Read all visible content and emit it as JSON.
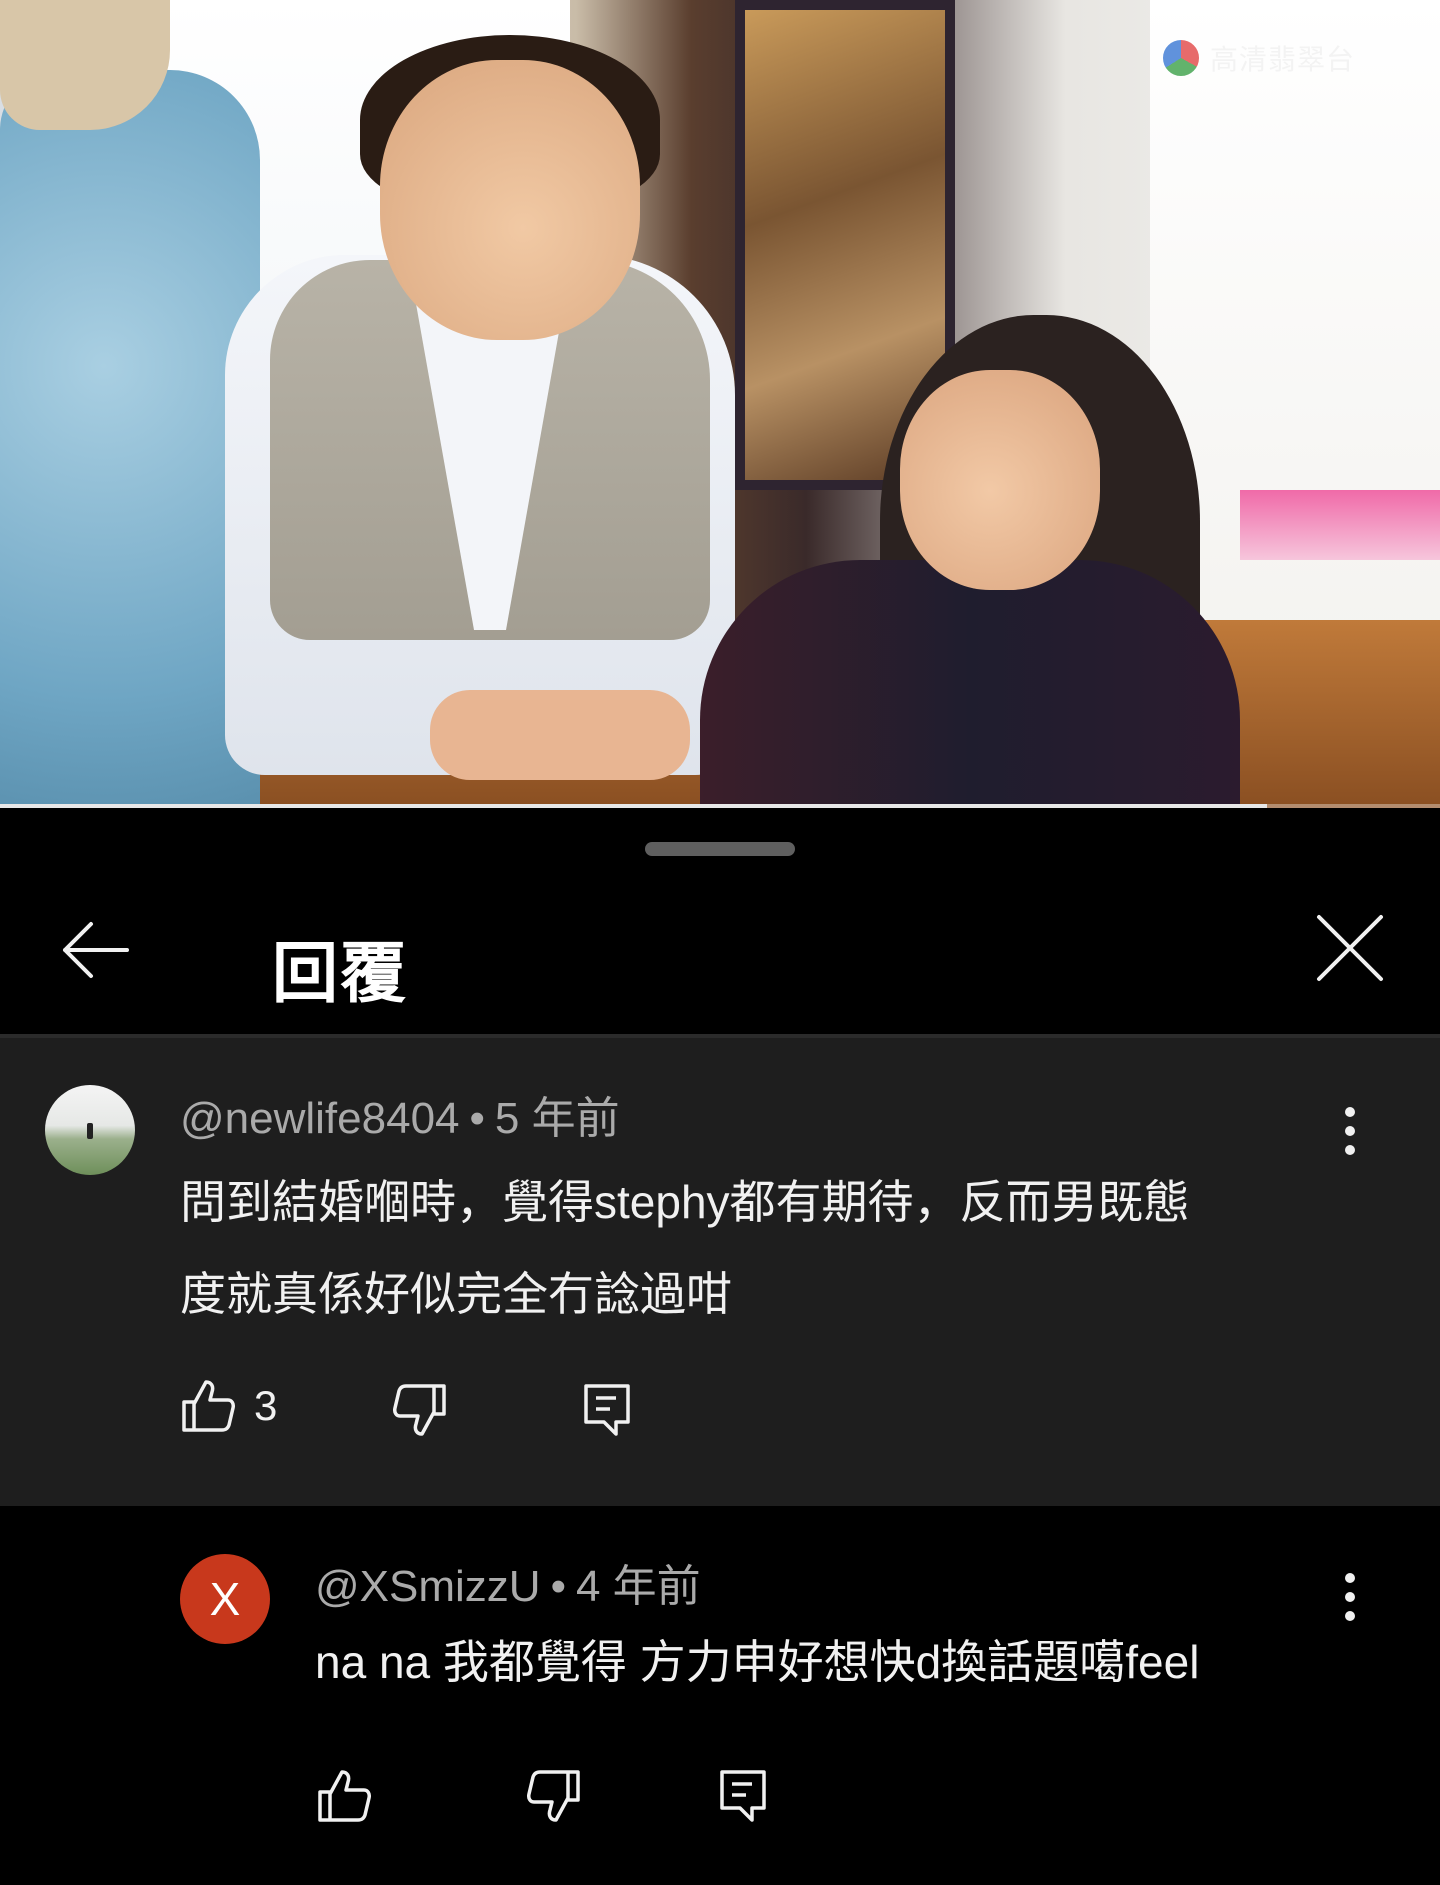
{
  "video": {
    "watermark": "高清翡翠台",
    "progress_fraction": 0.88
  },
  "header": {
    "title": "回覆"
  },
  "parent_comment": {
    "author": "@newlife8404",
    "separator": "•",
    "time": "5 年前",
    "text_line1": "問到結婚嗰時，覺得stephy都有期待，反而男既態",
    "text_line2": "度就真係好似完全冇諗過咁",
    "like_count": "3"
  },
  "reply_comment": {
    "avatar_letter": "X",
    "author": "@XSmizzU",
    "separator": "•",
    "time": "4 年前",
    "text": "na na 我都覺得 方力申好想快d換話題噶feel"
  },
  "colors": {
    "panel_bg": "#000000",
    "comment_bg": "#1e1e1e",
    "meta_gray": "#aaaaaa",
    "reply_avatar": "#c8381c"
  },
  "icons": {
    "back": "arrow-left-icon",
    "close": "close-icon",
    "like": "thumbs-up-icon",
    "dislike": "thumbs-down-icon",
    "reply": "reply-comment-icon",
    "more": "more-vertical-icon"
  }
}
